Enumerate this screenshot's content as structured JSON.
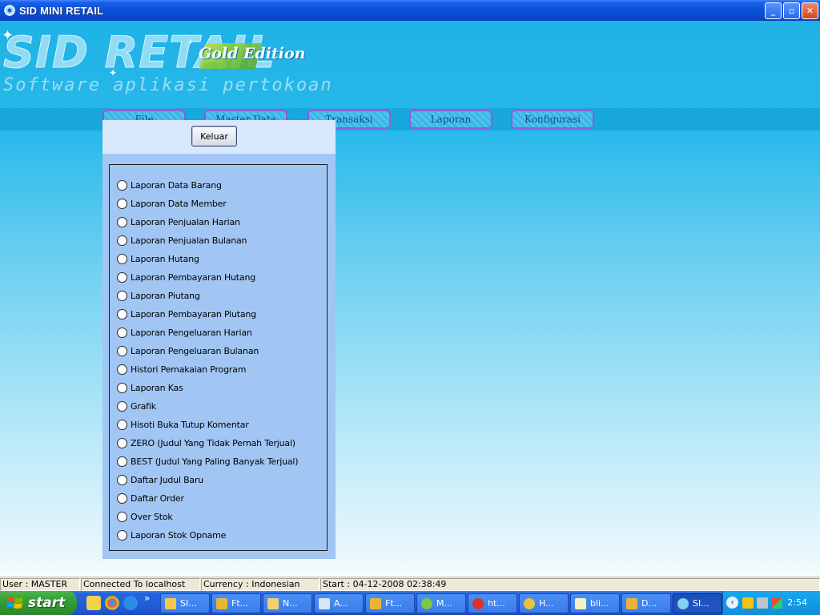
{
  "window": {
    "title": "SID MINI RETAIL",
    "minimize": "_",
    "maximize": "▫",
    "close": "✕"
  },
  "banner": {
    "logo": "SID RETAIL",
    "edition": "Gold Edition",
    "tagline": "Software aplikasi pertokoan"
  },
  "menu": {
    "items": [
      "File",
      "Master Data",
      "Transaksi",
      "Laporan",
      "Konfigurasi"
    ]
  },
  "panel": {
    "keluar_label": "Keluar",
    "options": [
      "Laporan Data Barang",
      "Laporan Data Member",
      "Laporan Penjualan Harian",
      "Laporan Penjualan Bulanan",
      "Laporan Hutang",
      "Laporan Pembayaran Hutang",
      "Laporan Piutang",
      "Laporan Pembayaran Piutang",
      "Laporan Pengeluaran Harian",
      "Laporan Pengeluaran Bulanan",
      "Histori Pemakaian Program",
      "Laporan Kas",
      "Grafik",
      "Hisoti Buka Tutup Komentar",
      "ZERO (Judul Yang Tidak Pernah Terjual)",
      "BEST (Judul Yang Paling Banyak Terjual)",
      "Daftar Judul Baru",
      "Daftar Order",
      "Over Stok",
      "Laporan Stok Opname"
    ]
  },
  "status": {
    "user": "User : MASTER",
    "connection": "Connected To localhost",
    "currency": "Currency : Indonesian",
    "start": "Start  : 04-12-2008 02:38:49"
  },
  "taskbar": {
    "start_label": "start",
    "more": "»",
    "buttons": [
      {
        "label": "SI...",
        "icon": "folder-icon",
        "color": "#f3c94a"
      },
      {
        "label": "Ft...",
        "icon": "ftp-icon",
        "color": "#e9b43a"
      },
      {
        "label": "N...",
        "icon": "hs-icon",
        "color": "#f0d070"
      },
      {
        "label": "A...",
        "icon": "app-icon",
        "color": "#d9e4f7"
      },
      {
        "label": "Ft...",
        "icon": "ftp-icon",
        "color": "#e9b43a"
      },
      {
        "label": "M...",
        "icon": "messenger-icon",
        "color": "#7ac943"
      },
      {
        "label": "ht...",
        "icon": "opera-icon",
        "color": "#d8322b"
      },
      {
        "label": "H...",
        "icon": "chrome-icon",
        "color": "#e8c33a"
      },
      {
        "label": "bli...",
        "icon": "notepad-icon",
        "color": "#f6f2c8"
      },
      {
        "label": "D...",
        "icon": "ftp-icon",
        "color": "#e9b43a"
      },
      {
        "label": "SI...",
        "icon": "sid-icon",
        "color": "#7fd0f2"
      }
    ],
    "clock": "2:54"
  }
}
